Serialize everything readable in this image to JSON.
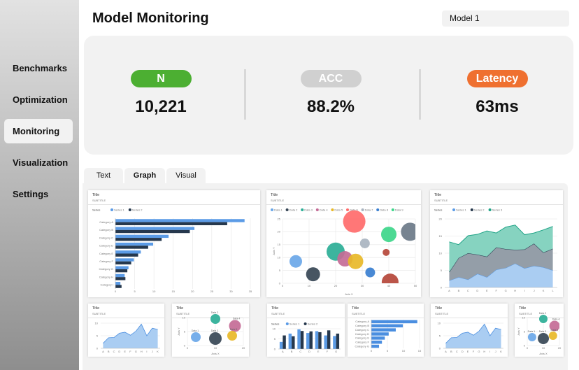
{
  "header": {
    "title": "Model Monitoring",
    "model_select": "Model 1"
  },
  "sidebar": {
    "items": [
      {
        "label": "Benchmarks"
      },
      {
        "label": "Optimization"
      },
      {
        "label": "Monitoring",
        "active": true
      },
      {
        "label": "Visualization"
      },
      {
        "label": "Settings"
      }
    ]
  },
  "metrics": [
    {
      "label": "N",
      "value": "10,221",
      "color": "#4caf32"
    },
    {
      "label": "ACC",
      "value": "88.2%",
      "color": "#d0d0d0"
    },
    {
      "label": "Latency",
      "value": "63ms",
      "color": "#ef7030"
    }
  ],
  "tabs": [
    {
      "label": "Text"
    },
    {
      "label": "Graph",
      "active": true
    },
    {
      "label": "Visual"
    }
  ],
  "charts": [
    {
      "type": "hbar",
      "title": "Title",
      "subtitle": "SUBTITLE",
      "legend_label": "Series",
      "categories": [
        "Category A",
        "Category B",
        "Category C",
        "Category D",
        "Category E",
        "Category F",
        "Category G",
        "Category H",
        "Category I"
      ],
      "xlim": [
        0,
        35
      ],
      "xticks": [
        0,
        5,
        10,
        15,
        20,
        25,
        30,
        35
      ],
      "series": [
        {
          "name": "Series 1",
          "color": "#5b9be6",
          "values": [
            33.5,
            20.5,
            13.8,
            9.8,
            6.6,
            4.8,
            3.4,
            2.4,
            1.3
          ]
        },
        {
          "name": "Series 2",
          "color": "#26384d",
          "values": [
            29,
            19.3,
            12,
            8.5,
            5.9,
            4.1,
            3.1,
            2.6,
            1.6
          ]
        }
      ]
    },
    {
      "type": "bubble",
      "title": "Title",
      "subtitle": "SUBTITLE",
      "xlabel": "Axis X",
      "ylabel": "Axis Y",
      "xlim": [
        0,
        50
      ],
      "ylim": [
        0,
        25
      ],
      "xticks": [
        0,
        10,
        20,
        30,
        40,
        50
      ],
      "yticks": [
        0,
        5,
        10,
        15,
        20,
        25
      ],
      "points": [
        {
          "name": "Data 1",
          "x": 5,
          "y": 8.5,
          "size": 9,
          "color": "#6aa7e8"
        },
        {
          "name": "Data 2",
          "x": 11.5,
          "y": 3.5,
          "size": 10,
          "color": "#374655"
        },
        {
          "name": "Data 3",
          "x": 20,
          "y": 12.3,
          "size": 13,
          "color": "#2bae96"
        },
        {
          "name": "Data 4",
          "x": 23.5,
          "y": 9.5,
          "size": 11,
          "color": "#c46b96"
        },
        {
          "name": "Data 5",
          "x": 27.5,
          "y": 8.5,
          "size": 11,
          "color": "#e8b828"
        },
        {
          "name": "Data 6",
          "x": 27,
          "y": 24,
          "size": 16,
          "color": "#ff6b6b"
        },
        {
          "name": "Data 7",
          "x": 31,
          "y": 15.5,
          "size": 7,
          "color": "#a9b4c0"
        },
        {
          "name": "Data 8",
          "x": 33,
          "y": 4.2,
          "size": 7,
          "color": "#3a7fd0"
        },
        {
          "name": "Data 9",
          "x": 40,
          "y": 19,
          "size": 11,
          "color": "#3dd68a"
        },
        {
          "x": 39,
          "y": 12,
          "size": 5,
          "color": "#b5473a"
        },
        {
          "x": 40.5,
          "y": 0.5,
          "size": 12,
          "color": "#b5473a"
        },
        {
          "x": 48,
          "y": 20,
          "size": 13,
          "color": "#6b7a88"
        }
      ]
    },
    {
      "type": "stacked_area",
      "title": "Title",
      "subtitle": "SUBTITLE",
      "legend_label": "Series",
      "categories": [
        "A",
        "B",
        "C",
        "D",
        "E",
        "F",
        "G",
        "H",
        "I",
        "J",
        "K",
        "L"
      ],
      "ylim": [
        0,
        20
      ],
      "yticks": [
        0,
        5,
        10,
        15,
        20
      ],
      "series": [
        {
          "name": "Series 1",
          "color": "#5b9be6",
          "fill": "#aacdf2",
          "values": [
            2,
            3,
            2.3,
            4,
            3,
            5.2,
            5.7,
            7,
            5.6,
            6.3,
            5.9,
            5
          ]
        },
        {
          "name": "Series 2",
          "color": "#26384d",
          "fill": "#949ea8",
          "values": [
            2.5,
            5.6,
            7.7,
            5.6,
            6,
            6.5,
            5.5,
            4,
            5.5,
            6.5,
            4.3,
            6.3
          ]
        },
        {
          "name": "Series 3",
          "color": "#1fa386",
          "fill": "#86d3c0",
          "values": [
            8.8,
            3.9,
            5.1,
            5.9,
            7.5,
            4.2,
            6.4,
            7.2,
            4.3,
            3.1,
            6.6,
            6.5
          ]
        }
      ]
    },
    {
      "type": "area",
      "title": "Title",
      "subtitle": "SUBTITLE",
      "categories": [
        "A",
        "B",
        "C",
        "D",
        "E",
        "F",
        "G",
        "H",
        "I",
        "J",
        "K"
      ],
      "ylim": [
        0,
        10
      ],
      "yticks": [
        0,
        5,
        10
      ],
      "series": [
        {
          "color": "#4a8ee0",
          "fill": "#aacdf2",
          "values": [
            2,
            4.2,
            4.3,
            6,
            6.4,
            5.2,
            6.8,
            9.6,
            5,
            8,
            7.5
          ]
        }
      ]
    },
    {
      "type": "bubble",
      "title": "Title",
      "subtitle": "SUBTITLE",
      "xlabel": "Axis X",
      "ylabel": "Axis Y",
      "labels": true,
      "xlim": [
        0,
        20
      ],
      "ylim": [
        0,
        10
      ],
      "xticks": [
        0,
        10,
        20
      ],
      "yticks": [
        0,
        5,
        10
      ],
      "points": [
        {
          "name": "Data 1",
          "x": 3,
          "y": 3,
          "size": 7,
          "color": "#6aa7e8"
        },
        {
          "name": "Data 2",
          "x": 10,
          "y": 9.5,
          "size": 7,
          "color": "#2bae96"
        },
        {
          "name": "Data 3",
          "x": 10,
          "y": 2.5,
          "size": 9,
          "color": "#374655"
        },
        {
          "name": "Data 4",
          "x": 17,
          "y": 7,
          "size": 8.5,
          "color": "#c46b96"
        },
        {
          "name": "Data 5",
          "x": 16,
          "y": 3.5,
          "size": 7,
          "color": "#e8b828"
        }
      ]
    },
    {
      "type": "column",
      "title": "Title",
      "subtitle": "SUBTITLE",
      "legend_label": "Series",
      "categories": [
        "A",
        "B",
        "C",
        "D",
        "E",
        "F",
        "G"
      ],
      "ylim": [
        0,
        10
      ],
      "yticks": [
        0,
        5,
        10
      ],
      "series": [
        {
          "name": "Series 1",
          "color": "#5b9be6",
          "values": [
            3.5,
            7.6,
            9.7,
            7.9,
            8.8,
            6.7,
            6.4
          ]
        },
        {
          "name": "Series 2",
          "color": "#26384d",
          "values": [
            6.7,
            6.3,
            8.9,
            8.7,
            8.3,
            9.2,
            7.6
          ]
        }
      ]
    },
    {
      "type": "hbar",
      "title": "Title",
      "subtitle": "SUBTITLE",
      "categories": [
        "Category A",
        "Category B",
        "Category C",
        "Category D",
        "Category E",
        "Category F",
        "Category G"
      ],
      "xlim": [
        0,
        15
      ],
      "xticks": [
        0,
        5,
        10,
        15
      ],
      "series": [
        {
          "color": "#4a8ee0",
          "values": [
            14.3,
            9.8,
            7.6,
            5.4,
            4.2,
            3.3,
            2.4
          ]
        }
      ]
    },
    {
      "type": "area",
      "title": "Title",
      "subtitle": "SUBTITLE",
      "categories": [
        "A",
        "B",
        "C",
        "D",
        "E",
        "F",
        "G",
        "H",
        "I",
        "J",
        "K"
      ],
      "ylim": [
        0,
        10
      ],
      "yticks": [
        0,
        5,
        10
      ],
      "series": [
        {
          "color": "#4a8ee0",
          "fill": "#aacdf2",
          "values": [
            2,
            4.2,
            4.3,
            6,
            6.4,
            5.2,
            6.8,
            9.6,
            5,
            8,
            7.5
          ]
        }
      ]
    },
    {
      "type": "bubble",
      "title": "Title",
      "subtitle": "SUBTITLE",
      "xlabel": "Axis X",
      "ylabel": "Axis Y",
      "labels": true,
      "xlim": [
        0,
        20
      ],
      "ylim": [
        0,
        10
      ],
      "xticks": [
        0,
        10,
        20
      ],
      "yticks": [
        0,
        5,
        10
      ],
      "points": [
        {
          "name": "Data 1",
          "x": 3,
          "y": 3,
          "size": 6,
          "color": "#6aa7e8"
        },
        {
          "name": "Data 2",
          "x": 10,
          "y": 9.5,
          "size": 6,
          "color": "#2bae96"
        },
        {
          "name": "Data 3",
          "x": 10,
          "y": 2.5,
          "size": 8,
          "color": "#374655"
        },
        {
          "name": "Data 4",
          "x": 17,
          "y": 7,
          "size": 7.5,
          "color": "#c46b96"
        },
        {
          "name": "Data 5",
          "x": 16,
          "y": 3.5,
          "size": 6,
          "color": "#e8b828"
        }
      ]
    }
  ]
}
